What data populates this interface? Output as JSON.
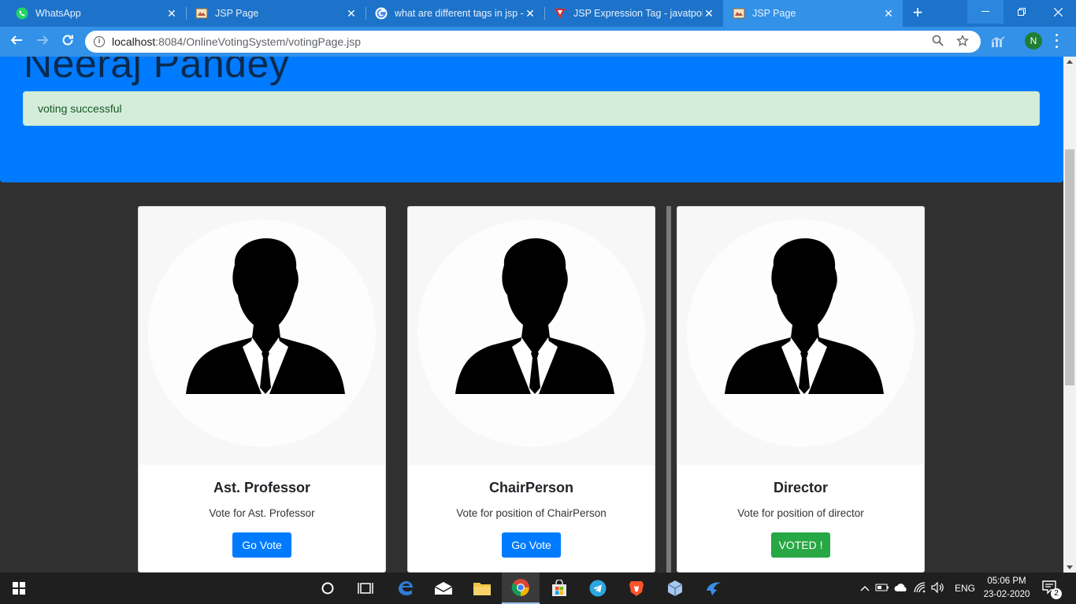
{
  "browser": {
    "tabs": [
      {
        "title": "WhatsApp",
        "icon": "whatsapp-icon",
        "active": false
      },
      {
        "title": "JSP Page",
        "icon": "jsp-page-icon",
        "active": false
      },
      {
        "title": "what are different tags in jsp -",
        "icon": "google-icon",
        "active": false
      },
      {
        "title": "JSP Expression Tag - javatpoint",
        "icon": "javatpoint-icon",
        "active": false
      },
      {
        "title": "JSP Page",
        "icon": "jsp-page-icon",
        "active": true
      }
    ],
    "address": {
      "host": "localhost",
      "path": ":8084/OnlineVotingSystem/votingPage.jsp"
    },
    "profile_initial": "N"
  },
  "page": {
    "user_name": "Neeraj Pandey",
    "alert_message": "voting successful",
    "cards": [
      {
        "title": "Ast. Professor",
        "description": "Vote for Ast. Professor",
        "button_label": "Go Vote",
        "voted": false
      },
      {
        "title": "ChairPerson",
        "description": "Vote for position of ChairPerson",
        "button_label": "Go Vote",
        "voted": false
      },
      {
        "title": "Director",
        "description": "Vote for position of director",
        "button_label": "VOTED !",
        "voted": true
      }
    ]
  },
  "colors": {
    "jumbotron": "#007bff",
    "alert_bg": "#d4edda",
    "primary_button": "#007bff",
    "success_button": "#28a745"
  },
  "taskbar": {
    "language": "ENG",
    "time": "05:06 PM",
    "date": "23-02-2020",
    "notification_count": "2"
  }
}
